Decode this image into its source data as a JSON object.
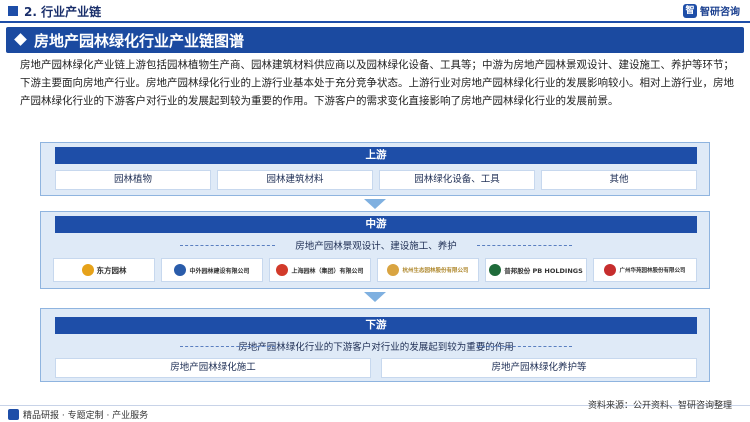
{
  "section": {
    "title": "2. 行业产业链"
  },
  "brand": {
    "mark": "智",
    "name": "智研咨询"
  },
  "banner": {
    "title": "房地产园林绿化行业产业链图谱"
  },
  "intro": "房地产园林绿化产业链上游包括园林植物生产商、园林建筑材料供应商以及园林绿化设备、工具等；中游为房地产园林景观设计、建设施工、养护等环节；下游主要面向房地产行业。房地产园林绿化行业的上游行业基本处于充分竞争状态。上游行业对房地产园林绿化行业的发展影响较小。相对上游行业，房地产园林绿化行业的下游客户对行业的发展起到较为重要的作用。下游客户的需求变化直接影响了房地产园林绿化行业的发展前景。",
  "upstream": {
    "title": "上游",
    "items": [
      "园林植物",
      "园林建筑材料",
      "园林绿化设备、工具",
      "其他"
    ]
  },
  "midstream": {
    "title": "中游",
    "subtitle": "房地产园林景观设计、建设施工、养护",
    "companies": [
      {
        "name": "东方园林",
        "color": "#e6a21a"
      },
      {
        "name": "中外园林建设有限公司",
        "color": "#2a5caa"
      },
      {
        "name": "上海园林（集团）有限公司",
        "color": "#d23a2a"
      },
      {
        "name": "杭州生态园林股份有限公司",
        "color": "#d9a441"
      },
      {
        "name": "普邦股份 PB HOLDINGS",
        "color": "#1f6b3a"
      },
      {
        "name": "广州华苑园林股份有限公司",
        "color": "#c62d2d"
      }
    ]
  },
  "downstream": {
    "title": "下游",
    "subtitle": "房地产园林绿化行业的下游客户对行业的发展起到较为重要的作用",
    "items": [
      "房地产园林绿化施工",
      "房地产园林绿化养护等"
    ]
  },
  "footer": {
    "left": "精品研报 · 专题定制 · 产业服务",
    "source": "资料来源：公开资料、智研咨询整理"
  },
  "colors": {
    "primary": "#1e4ea8",
    "panel": "#dfeaf7",
    "arrow": "#7fb0e0"
  }
}
